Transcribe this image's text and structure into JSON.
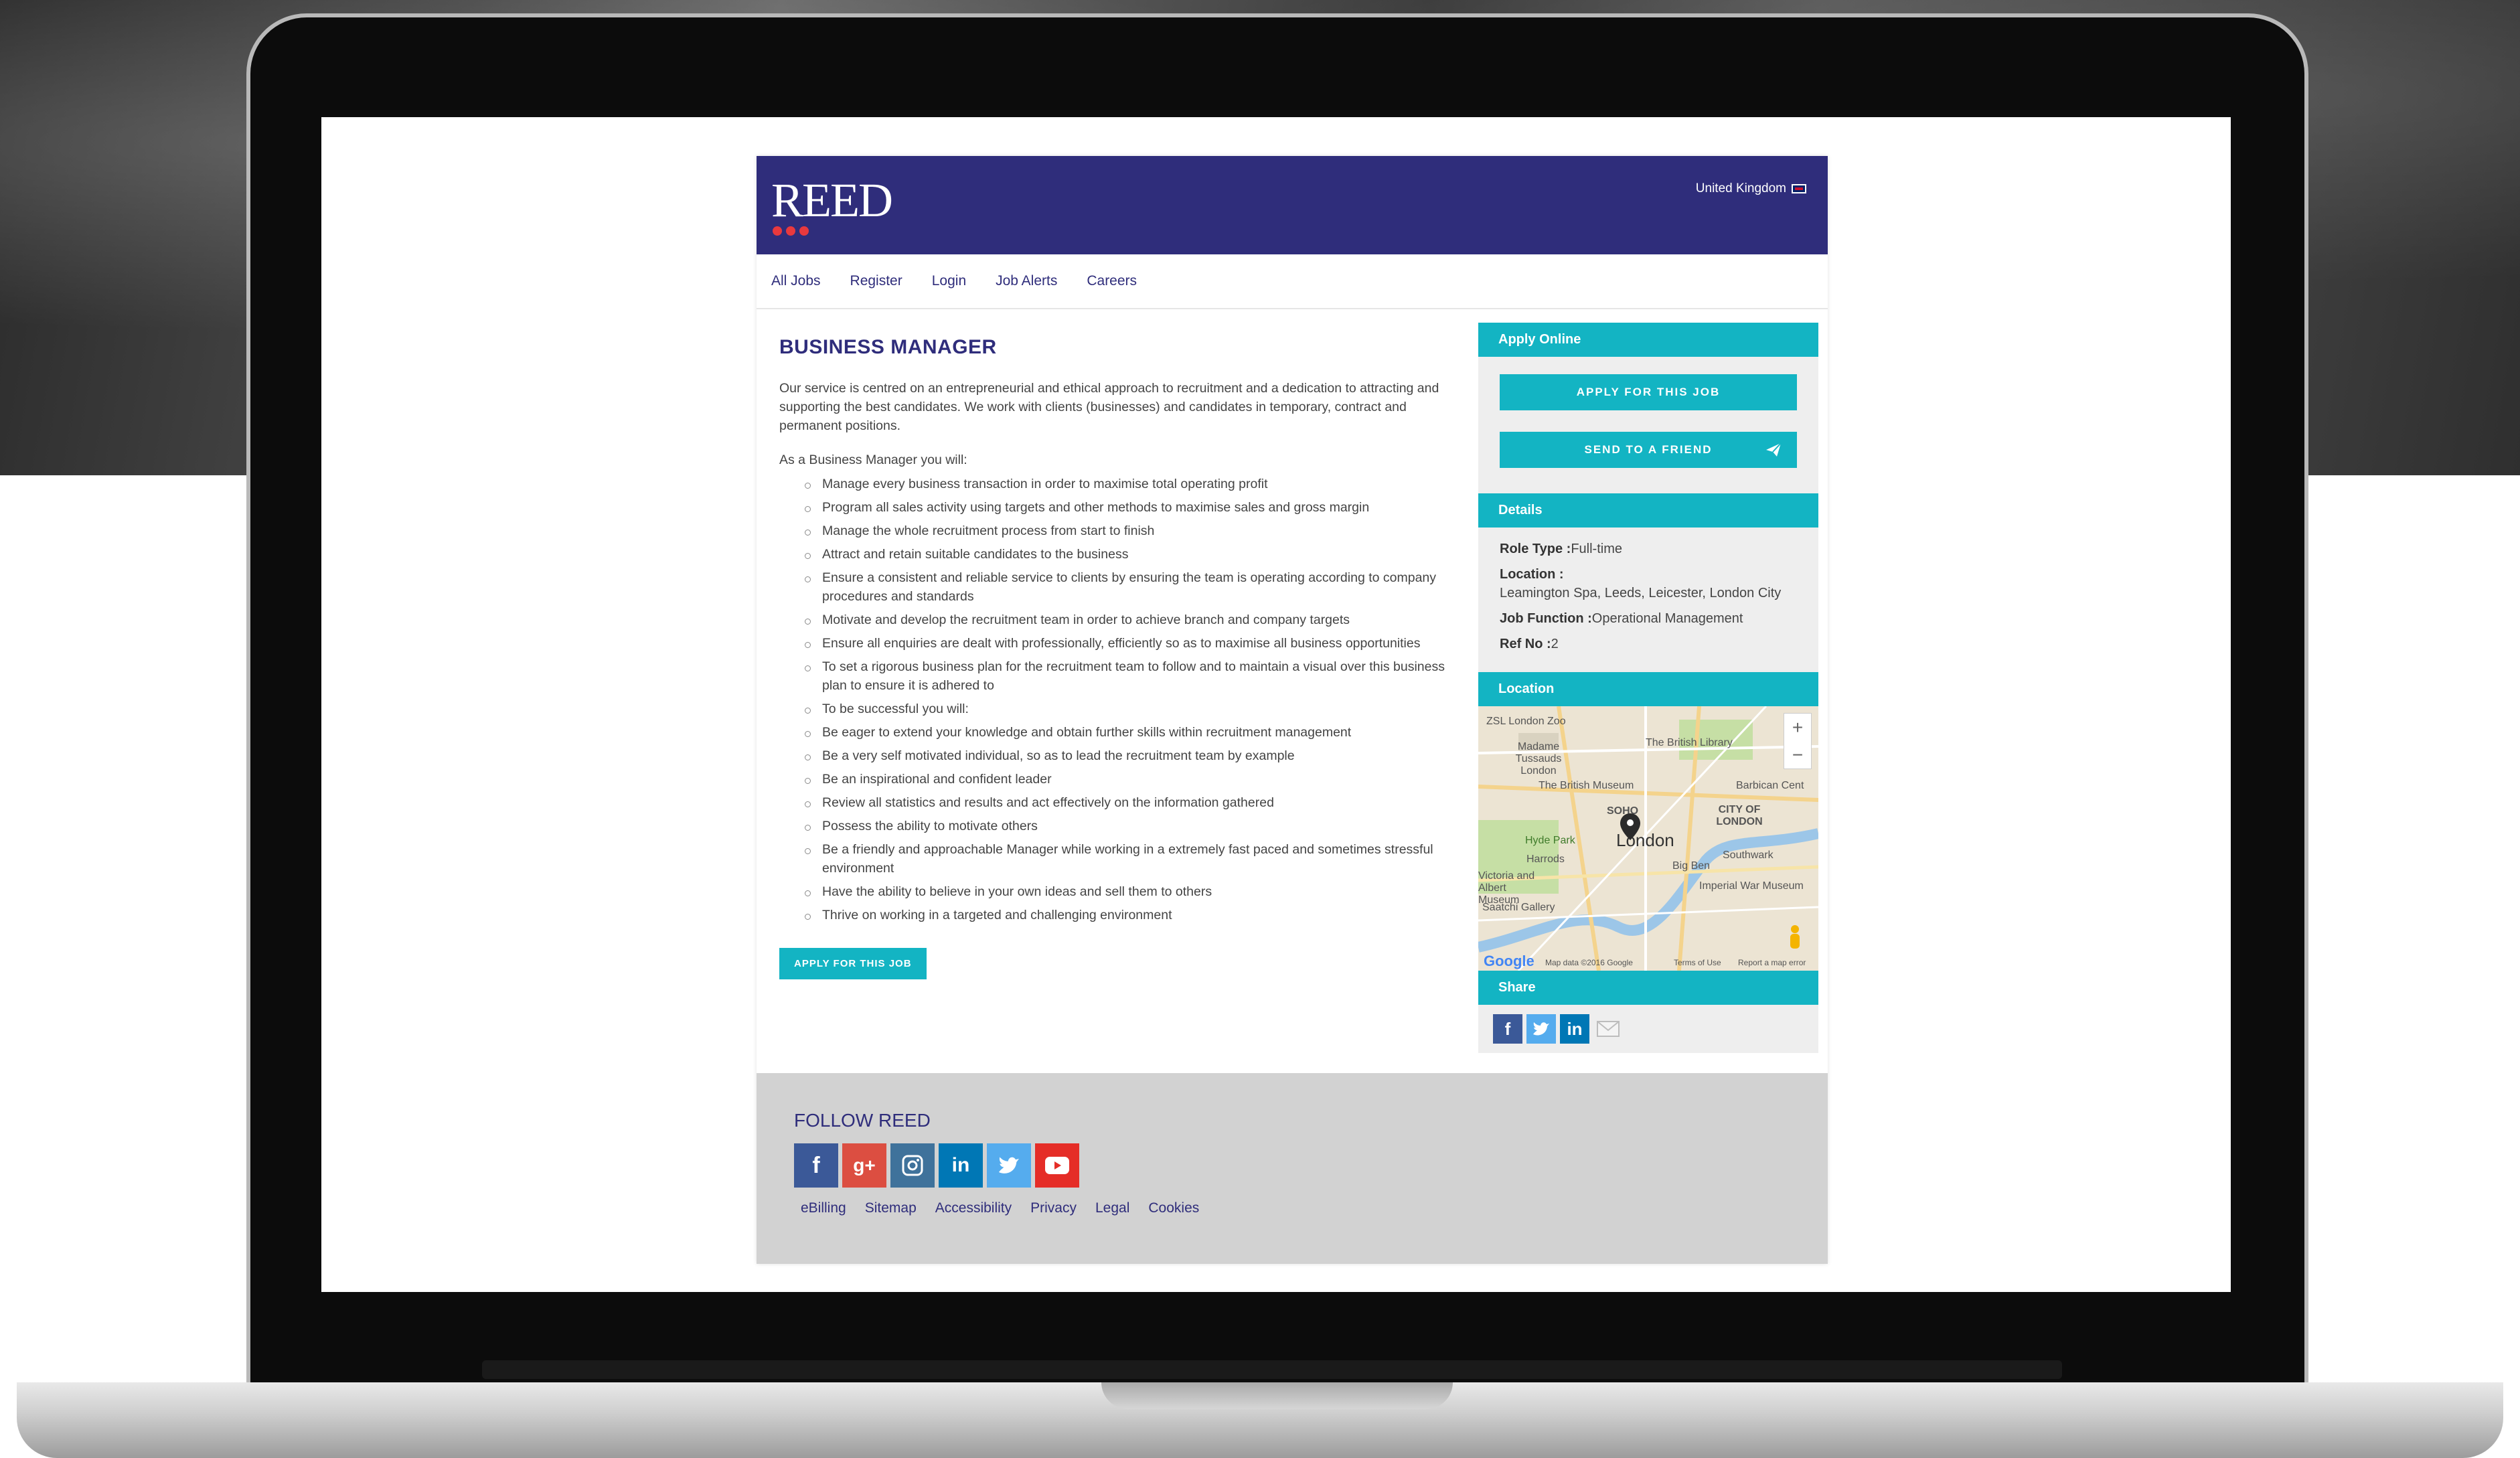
{
  "header": {
    "logo_text": "REED",
    "country": "United Kingdom"
  },
  "nav": {
    "items": [
      "All Jobs",
      "Register",
      "Login",
      "Job Alerts",
      "Careers"
    ]
  },
  "job": {
    "title": "BUSINESS MANAGER",
    "intro": "Our service is centred on an entrepreneurial and ethical approach to recruitment and a dedication to attracting and supporting the best candidates. We work with clients (businesses) and candidates in temporary, contract and permanent positions.",
    "lead": "As a Business Manager you will:",
    "duties": [
      "Manage every business transaction in order to maximise total operating profit",
      "Program all sales activity using targets and other methods to maximise sales and gross margin",
      "Manage the whole recruitment process from start to finish",
      "Attract and retain suitable candidates to the business",
      "Ensure a consistent and reliable service to clients by ensuring the team is operating according to company procedures and standards",
      "Motivate and develop the recruitment team in order to achieve branch and company targets",
      "Ensure all enquiries are dealt with professionally, efficiently so as to maximise all business opportunities",
      "To set a rigorous business plan for the recruitment team to follow and to maintain a visual over this business plan to ensure it is adhered to",
      "To be successful you will:",
      "Be eager to extend your knowledge and obtain further skills within recruitment management",
      "Be a very self motivated individual, so as to lead the recruitment team by example",
      "Be an inspirational and confident leader",
      "Review all statistics and results and act effectively on the information gathered",
      "Possess the ability to motivate others",
      "Be a friendly and approachable Manager while working in a extremely fast paced and sometimes stressful environment",
      "Have the ability to believe in your own ideas and sell them to others",
      "Thrive on working in a targeted and challenging environment"
    ],
    "apply_button": "APPLY FOR THIS JOB"
  },
  "sidebar": {
    "apply_title": "Apply Online",
    "apply_button": "APPLY FOR THIS JOB",
    "send_button": "SEND TO A FRIEND",
    "details_title": "Details",
    "role_type_label": "Role Type :",
    "role_type_value": "Full-time",
    "location_label": "Location :",
    "location_value": "Leamington Spa, Leeds, Leicester, London City",
    "job_function_label": "Job Function :",
    "job_function_value": "Operational Management",
    "ref_label": "Ref No :",
    "ref_value": "2",
    "location_title": "Location",
    "map": {
      "labels": [
        "ZSL London Zoo",
        "Madame Tussauds London",
        "The British Library",
        "The British Museum",
        "Barbican Cent",
        "SOHO",
        "CITY OF LONDON",
        "Hyde Park",
        "London",
        "Harrods",
        "Big Ben",
        "Southwark",
        "Imperial War Museum",
        "Saatchi Gallery",
        "Victoria and Albert Museum",
        "Google",
        "Map data ©2016 Google",
        "Terms of Use",
        "Report a map error"
      ],
      "zoom_in": "+",
      "zoom_out": "−"
    },
    "share_title": "Share"
  },
  "footer": {
    "follow_title": "FOLLOW REED",
    "links": [
      "eBilling",
      "Sitemap",
      "Accessibility",
      "Privacy",
      "Legal",
      "Cookies"
    ]
  },
  "colors": {
    "brand_navy": "#2f2d7b",
    "accent_teal": "#13b4c3",
    "logo_red": "#e8393e",
    "facebook": "#3b5998",
    "google_plus": "#dc4e41",
    "instagram": "#3f729b",
    "linkedin": "#0077b5",
    "twitter": "#55acee",
    "youtube": "#e52d27"
  }
}
